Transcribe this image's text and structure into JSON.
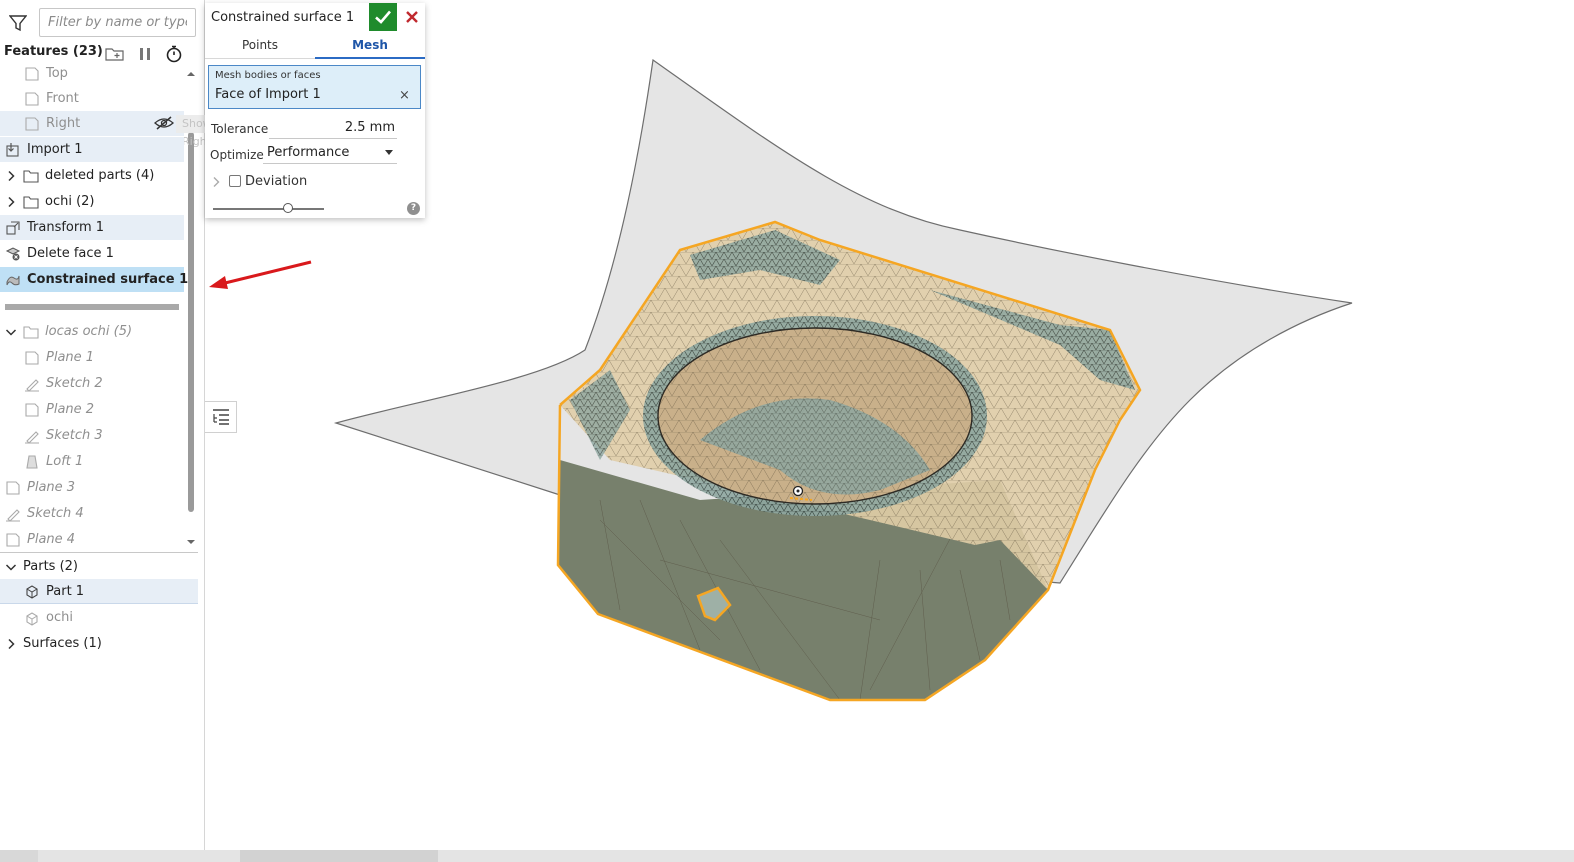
{
  "filter": {
    "placeholder": "Filter by name or type"
  },
  "features_header": {
    "label": "Features (23)"
  },
  "tooltip": {
    "text": "Show Right"
  },
  "tree": {
    "top": "Top",
    "front": "Front",
    "right": "Right",
    "import1": "Import 1",
    "deleted_parts": "deleted parts (4)",
    "ochi_folder": "ochi (2)",
    "transform1": "Transform 1",
    "delete_face1": "Delete face 1",
    "constrained_surface1": "Constrained surface 1",
    "locas_ochi": "locas ochi (5)",
    "plane1": "Plane 1",
    "sketch2": "Sketch 2",
    "plane2": "Plane 2",
    "sketch3": "Sketch 3",
    "loft1": "Loft 1",
    "plane3": "Plane 3",
    "sketch4": "Sketch 4",
    "plane4": "Plane 4"
  },
  "parts": {
    "header": "Parts (2)",
    "part1": "Part 1",
    "ochi": "ochi",
    "surfaces": "Surfaces (1)"
  },
  "dialog": {
    "title": "Constrained surface 1",
    "tabs": [
      "Points",
      "Mesh"
    ],
    "active_tab": "Mesh",
    "mesh_label": "Mesh bodies or faces",
    "mesh_value": "Face of Import 1",
    "mesh_clear": "×",
    "tolerance_label": "Tolerance",
    "tolerance_value": "2.5 mm",
    "optimize_label": "Optimize",
    "optimize_value": "Performance",
    "deviation_label": "Deviation",
    "deviation_checked": false,
    "slider_level": 0.68,
    "help": "?"
  },
  "colors": {
    "ok_green": "#1f8b2c",
    "cancel_red": "#c0282e",
    "selection_blue": "#bfe0f5",
    "annotation_red": "#d9191c",
    "highlight_orange": "#f5a623"
  }
}
